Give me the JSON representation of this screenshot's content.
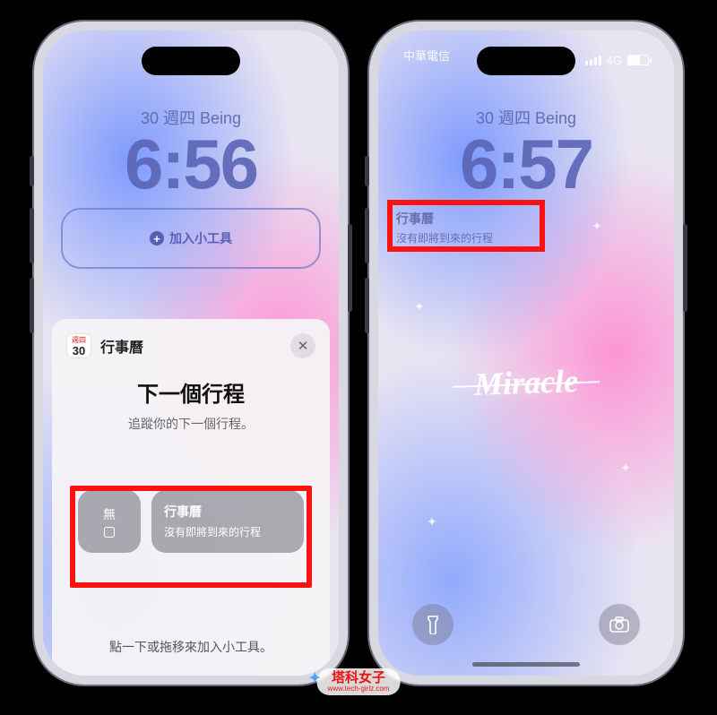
{
  "left": {
    "date_line": "30 週四 Being",
    "time": "6:56",
    "add_widget_label": "加入小工具",
    "sheet": {
      "app_name": "行事曆",
      "icon_top": "週四",
      "icon_day": "30",
      "title": "下一個行程",
      "subtitle": "追蹤你的下一個行程。",
      "small_preview_label": "無",
      "large_preview_title": "行事曆",
      "large_preview_sub": "沒有即將到來的行程",
      "hint": "點一下或拖移來加入小工具。"
    }
  },
  "right": {
    "carrier": "中華電信",
    "network": "4G",
    "date_line": "30 週四 Being",
    "time": "6:57",
    "widget_title": "行事曆",
    "widget_sub": "沒有即將到來的行程",
    "wallpaper_text": "Miracle"
  },
  "watermark": {
    "name": "塔科女子",
    "url": "www.tech-girlz.com"
  }
}
